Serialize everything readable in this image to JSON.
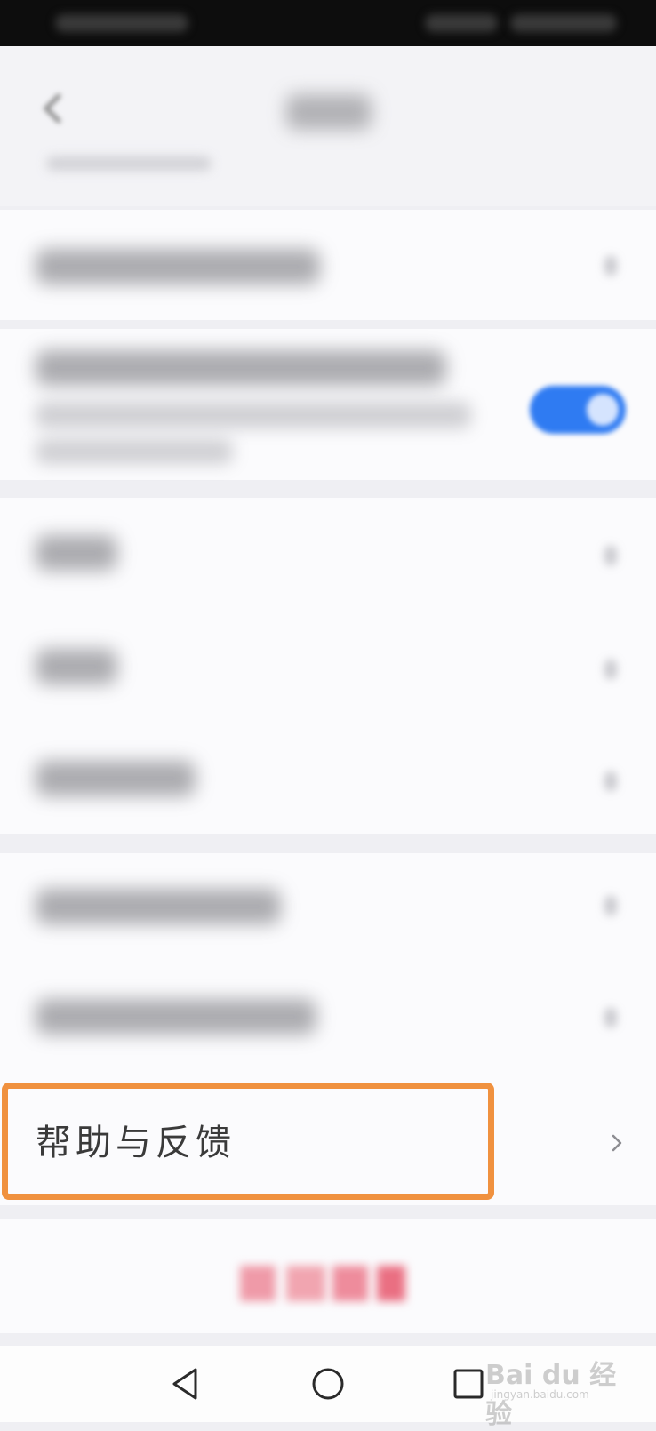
{
  "settings": {
    "help_feedback_label": "帮助与反馈"
  },
  "watermark": {
    "logo_text": "Bai du 经验",
    "url_text": "jingyan.baidu.com"
  },
  "colors": {
    "highlight": "#f0913f",
    "toggle_on": "#2f7bf2",
    "background": "#efeff3"
  },
  "icons": {
    "back": "chevron-left-icon",
    "row_arrow": "chevron-right-icon",
    "nav_back": "triangle-back-icon",
    "nav_home": "circle-home-icon",
    "nav_recent": "square-recent-icon"
  }
}
